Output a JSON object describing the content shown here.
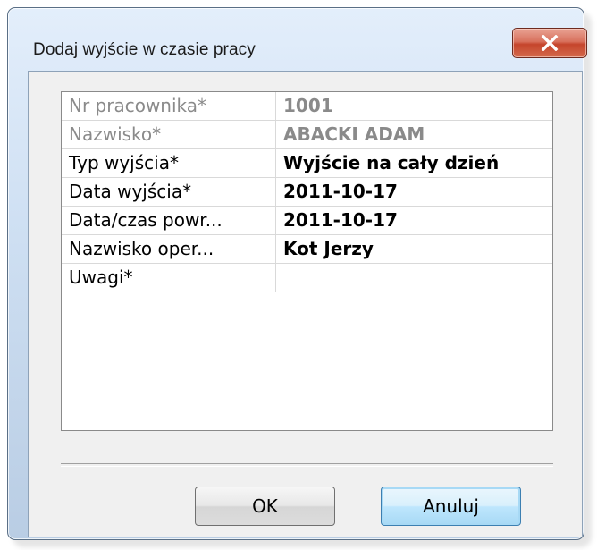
{
  "window": {
    "title": "Dodaj wyjście w czasie pracy",
    "close_icon": "close-x-icon"
  },
  "colors": {
    "frame": "#b9cde4",
    "close_button": "#c5452c",
    "disabled_text": "#8a8a8a"
  },
  "grid": {
    "rows": [
      {
        "label": "Nr pracownika*",
        "value": "1001",
        "readonly": true
      },
      {
        "label": "Nazwisko*",
        "value": "ABACKI ADAM",
        "readonly": true
      },
      {
        "label": "Typ wyjścia*",
        "value": "Wyjście na cały dzień",
        "readonly": false
      },
      {
        "label": "Data wyjścia*",
        "value": "2011-10-17",
        "readonly": false
      },
      {
        "label": "Data/czas powr...",
        "value": "2011-10-17",
        "readonly": false
      },
      {
        "label": "Nazwisko oper...",
        "value": "Kot Jerzy",
        "readonly": false
      },
      {
        "label": "Uwagi*",
        "value": "",
        "readonly": false
      }
    ]
  },
  "buttons": {
    "ok": "OK",
    "cancel": "Anuluj"
  }
}
